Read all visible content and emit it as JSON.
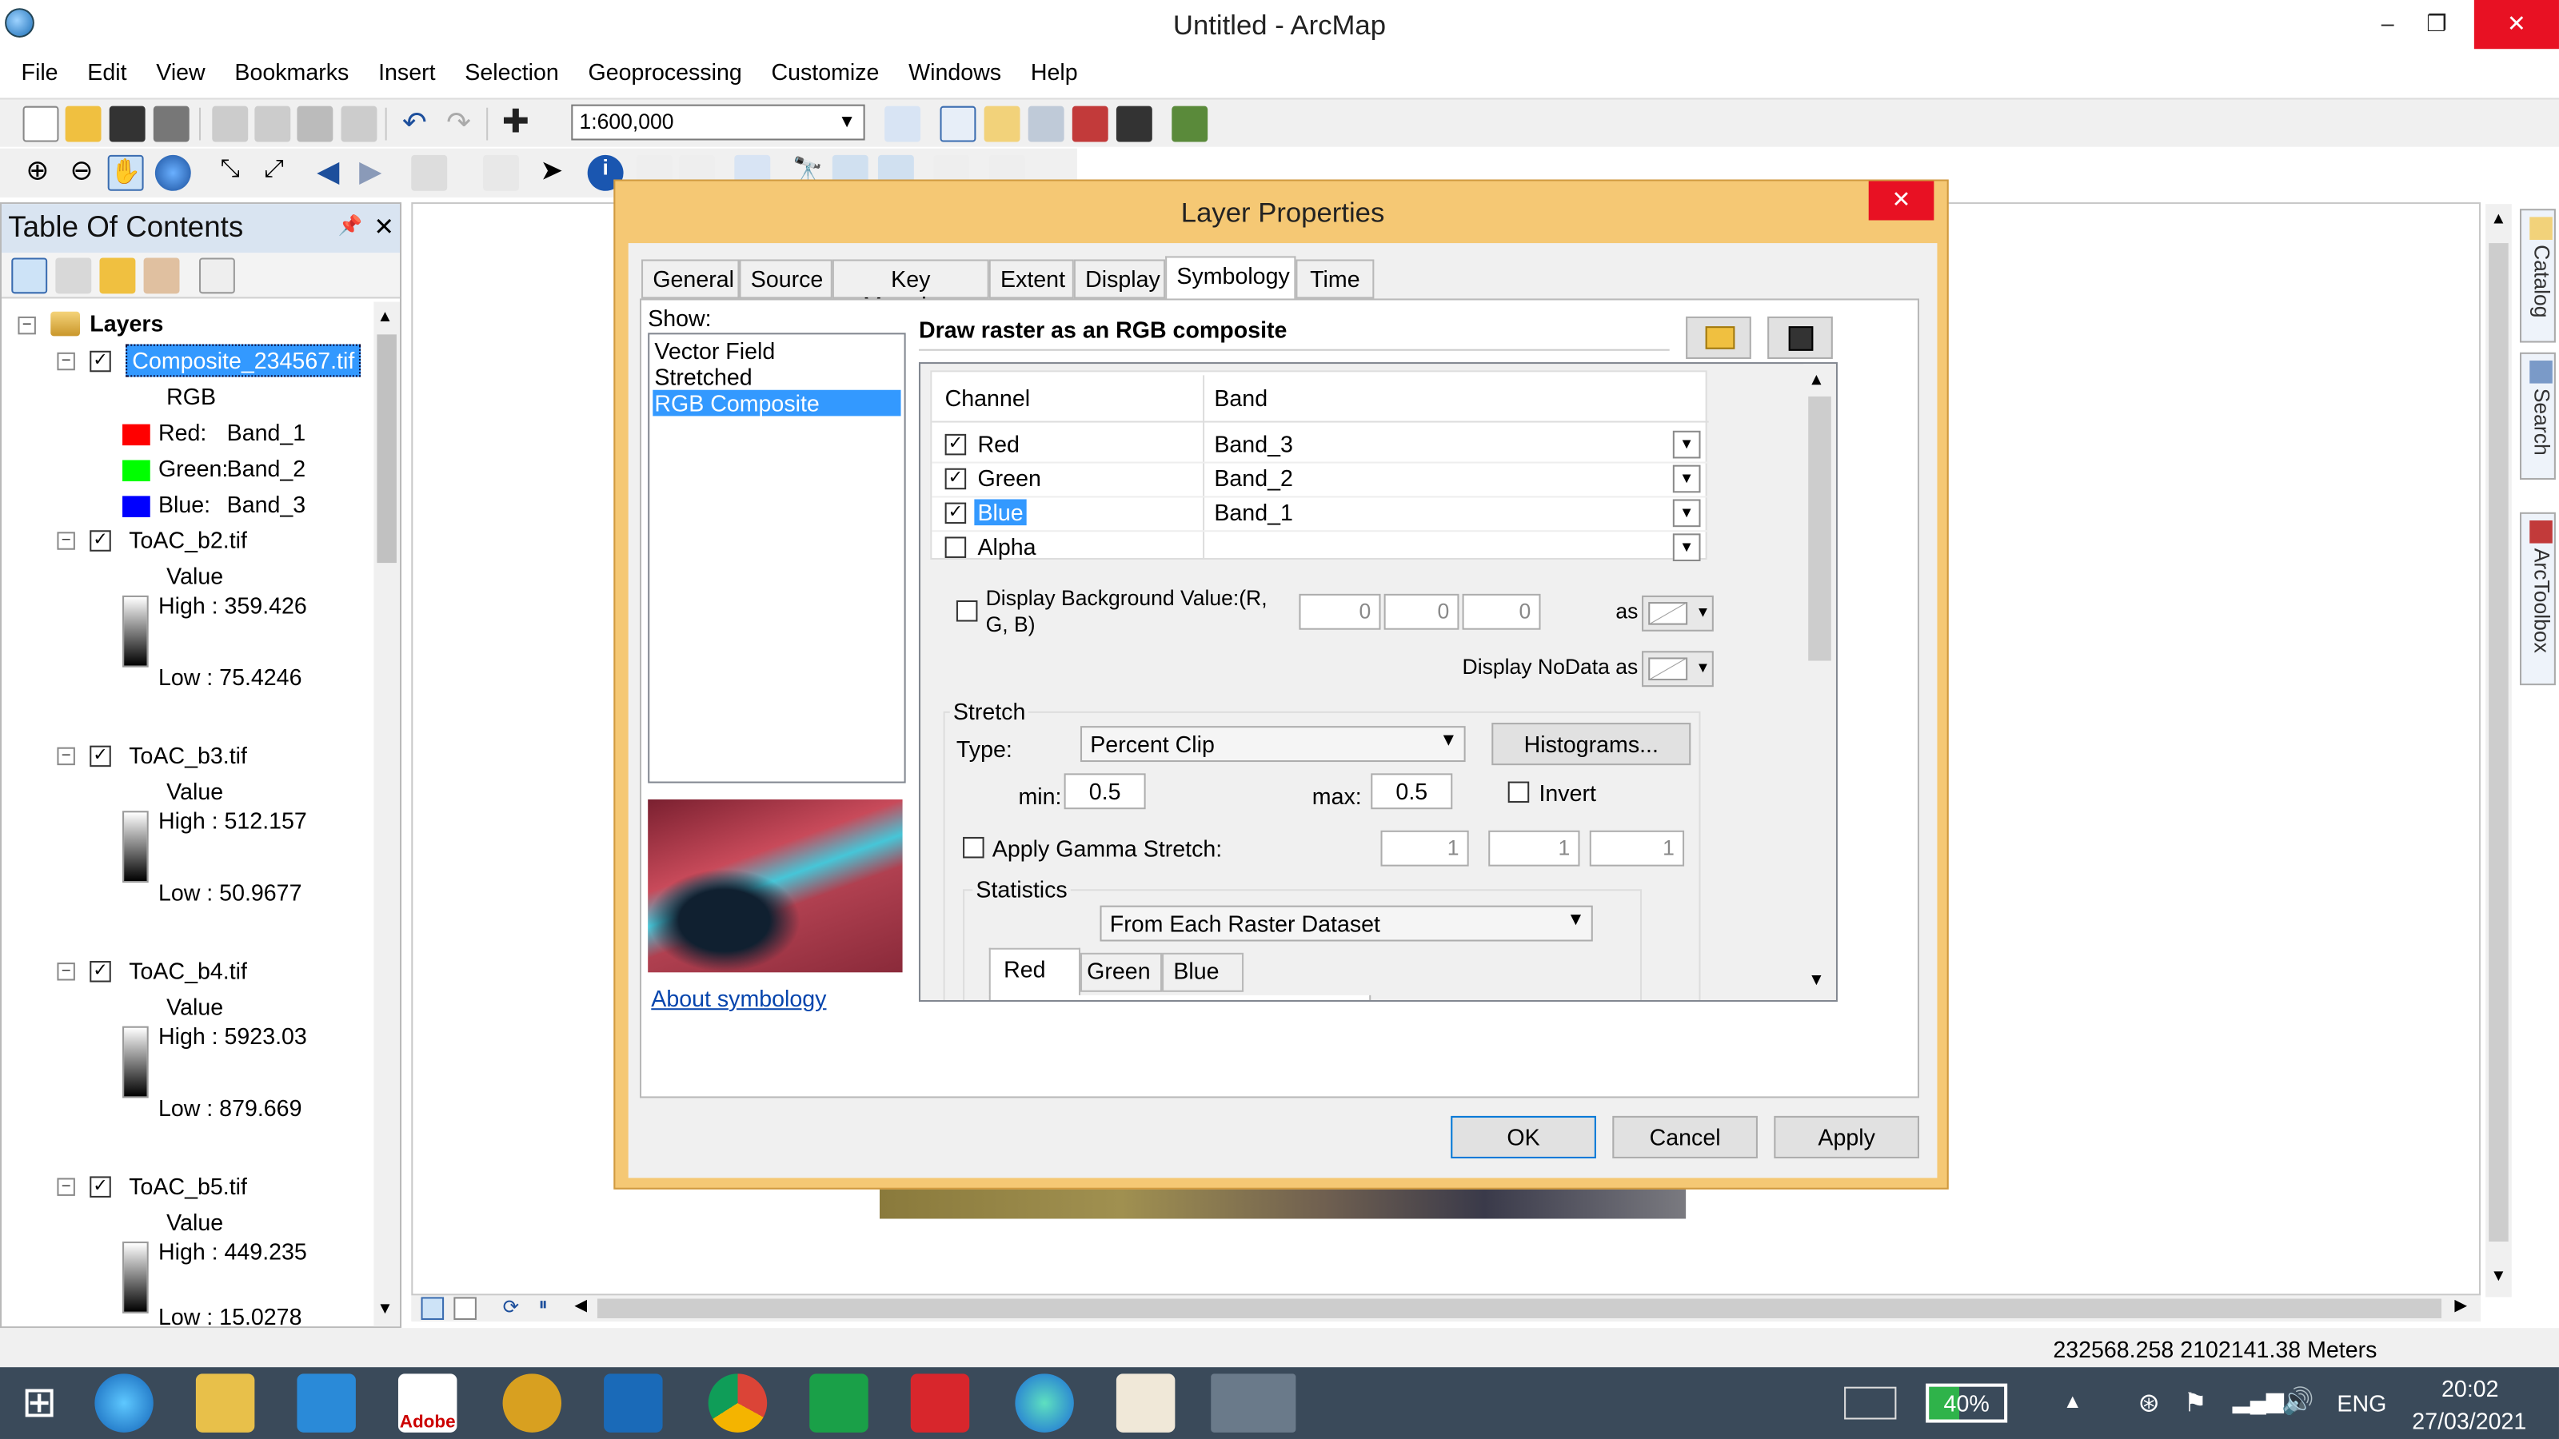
{
  "app": {
    "title": "Untitled - ArcMap",
    "min": "–",
    "restore": "❐",
    "close": "✕"
  },
  "menu": [
    "File",
    "Edit",
    "View",
    "Bookmarks",
    "Insert",
    "Selection",
    "Geoprocessing",
    "Customize",
    "Windows",
    "Help"
  ],
  "toolbar": {
    "scale": "1:600,000"
  },
  "toc": {
    "title": "Table Of Contents",
    "pin": "📌",
    "close": "✕",
    "root": "Layers",
    "composite": {
      "name": "Composite_234567.tif",
      "sub": "RGB",
      "red_label": "Red:",
      "red_band": "Band_1",
      "green_label": "Green:",
      "green_band": "Band_2",
      "blue_label": "Blue:",
      "blue_band": "Band_3"
    },
    "layers": [
      {
        "name": "ToAC_b2.tif",
        "value": "Value",
        "high": "High : 359.426",
        "low": "Low : 75.4246"
      },
      {
        "name": "ToAC_b3.tif",
        "value": "Value",
        "high": "High : 512.157",
        "low": "Low : 50.9677"
      },
      {
        "name": "ToAC_b4.tif",
        "value": "Value",
        "high": "High : 5923.03",
        "low": "Low : 879.669"
      },
      {
        "name": "ToAC_b5.tif",
        "value": "Value",
        "high": "High : 449.235",
        "low": "Low : 15.0278"
      }
    ]
  },
  "dock": {
    "catalog": "Catalog",
    "search": "Search",
    "toolbox": "ArcToolbox"
  },
  "status": {
    "coords": "232568.258  2102141.38 Meters"
  },
  "dialog": {
    "title": "Layer Properties",
    "close": "✕",
    "tabs": [
      "General",
      "Source",
      "Key Metadata",
      "Extent",
      "Display",
      "Symbology",
      "Time"
    ],
    "show_label": "Show:",
    "show_items": [
      "Vector Field",
      "Stretched",
      "RGB Composite"
    ],
    "about": "About symbology",
    "heading": "Draw raster as an RGB composite",
    "col_channel": "Channel",
    "col_band": "Band",
    "channels": [
      {
        "name": "Red",
        "band": "Band_3"
      },
      {
        "name": "Green",
        "band": "Band_2"
      },
      {
        "name": "Blue",
        "band": "Band_1"
      },
      {
        "name": "Alpha",
        "band": ""
      }
    ],
    "bg_label": "Display Background Value:(R, G, B)",
    "bg_vals": [
      "0",
      "0",
      "0"
    ],
    "as": "as",
    "nodata_label": "Display NoData as",
    "stretch": "Stretch",
    "type_label": "Type:",
    "type_value": "Percent Clip",
    "histograms": "Histograms...",
    "min_label": "min:",
    "min_value": "0.5",
    "max_label": "max:",
    "max_value": "0.5",
    "invert": "Invert",
    "gamma_label": "Apply Gamma Stretch:",
    "gamma_vals": [
      "1",
      "1",
      "1"
    ],
    "statistics": "Statistics",
    "stats_value": "From Each Raster Dataset",
    "subtabs": [
      "Red",
      "Green",
      "Blue"
    ],
    "ok": "OK",
    "cancel": "Cancel",
    "apply": "Apply"
  },
  "taskbar": {
    "battery": "40%",
    "lang": "ENG",
    "time": "20:02",
    "date": "27/03/2021",
    "adobe": "Adobe"
  }
}
